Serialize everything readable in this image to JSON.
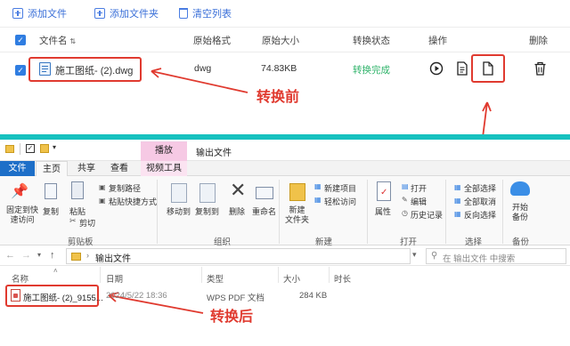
{
  "toolbar": {
    "add_file": "添加文件",
    "add_folder": "添加文件夹",
    "clear_list": "清空列表"
  },
  "table": {
    "headers": {
      "name": "文件名",
      "orig_format": "原始格式",
      "orig_size": "原始大小",
      "status": "转换状态",
      "actions": "操作",
      "delete": "删除"
    },
    "row": {
      "name": "施工图纸- (2).dwg",
      "format": "dwg",
      "size": "74.83KB",
      "status": "转换完成"
    }
  },
  "annotations": {
    "before": "转换前",
    "after": "转换后"
  },
  "explorer": {
    "manage_tab": "播放",
    "window_title": "输出文件",
    "tabs": [
      "文件",
      "主页",
      "共享",
      "查看",
      "视频工具"
    ],
    "ribbon": {
      "pin": "固定到快\n速访问",
      "copy": "复制",
      "paste": "粘贴",
      "copy_path": "复制路径",
      "paste_shortcut": "粘贴快捷方式",
      "cut": "剪切",
      "move_to": "移动到",
      "copy_to": "复制到",
      "delete": "删除",
      "rename": "重命名",
      "new_folder": "新建\n文件夹",
      "new_item": "新建项目",
      "easy_access": "轻松访问",
      "properties": "属性",
      "open": "打开",
      "edit": "编辑",
      "history": "历史记录",
      "select_all": "全部选择",
      "select_none": "全部取消",
      "invert": "反向选择",
      "start_backup": "开始\n备份"
    },
    "groups": {
      "clipboard": "剪贴板",
      "organize": "组织",
      "new": "新建",
      "open": "打开",
      "select": "选择",
      "backup": "备份"
    },
    "address": "输出文件",
    "search_placeholder": "在 输出文件 中搜索",
    "columns": {
      "name": "名称",
      "date": "日期",
      "type": "类型",
      "size": "大小",
      "duration": "时长"
    },
    "file": {
      "name": "施工图纸- (2)_9155...",
      "date": "2024/5/22 18:36",
      "type": "WPS PDF 文档",
      "size": "284 KB"
    }
  },
  "colors": {
    "accent": "#2f7de1",
    "success": "#2fb36a",
    "annotation": "#e03a2f",
    "teal": "#17c1bf",
    "manage_tab": "#f6c9e4"
  }
}
